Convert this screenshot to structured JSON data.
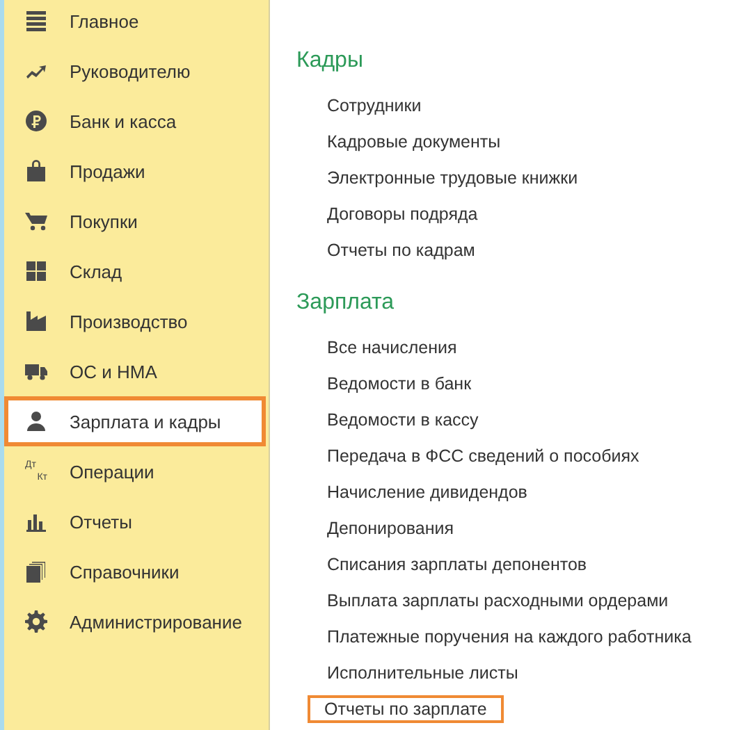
{
  "sidebar": {
    "items": [
      {
        "label": "Главное",
        "kind": "menu",
        "selected": false
      },
      {
        "label": "Руководителю",
        "kind": "trend",
        "selected": false
      },
      {
        "label": "Банк и касса",
        "kind": "ruble",
        "selected": false
      },
      {
        "label": "Продажи",
        "kind": "bag",
        "selected": false
      },
      {
        "label": "Покупки",
        "kind": "cart",
        "selected": false
      },
      {
        "label": "Склад",
        "kind": "grid",
        "selected": false
      },
      {
        "label": "Производство",
        "kind": "factory",
        "selected": false
      },
      {
        "label": "ОС и НМА",
        "kind": "truck",
        "selected": false
      },
      {
        "label": "Зарплата и кадры",
        "kind": "person",
        "selected": true
      },
      {
        "label": "Операции",
        "kind": "debit-credit",
        "icon_text": [
          "Дт",
          "Кт"
        ],
        "selected": false
      },
      {
        "label": "Отчеты",
        "kind": "chart",
        "selected": false
      },
      {
        "label": "Справочники",
        "kind": "books",
        "selected": false
      },
      {
        "label": "Администрирование",
        "kind": "gear",
        "selected": false
      }
    ]
  },
  "sections": [
    {
      "title": "Кадры",
      "links": [
        {
          "label": "Сотрудники",
          "highlighted": false
        },
        {
          "label": "Кадровые документы",
          "highlighted": false
        },
        {
          "label": "Электронные трудовые книжки",
          "highlighted": false
        },
        {
          "label": "Договоры подряда",
          "highlighted": false
        },
        {
          "label": "Отчеты по кадрам",
          "highlighted": false
        }
      ]
    },
    {
      "title": "Зарплата",
      "links": [
        {
          "label": "Все начисления",
          "highlighted": false
        },
        {
          "label": "Ведомости в банк",
          "highlighted": false
        },
        {
          "label": "Ведомости в кассу",
          "highlighted": false
        },
        {
          "label": "Передача в ФСС сведений о пособиях",
          "highlighted": false
        },
        {
          "label": "Начисление дивидендов",
          "highlighted": false
        },
        {
          "label": "Депонирования",
          "highlighted": false
        },
        {
          "label": "Списания зарплаты депонентов",
          "highlighted": false
        },
        {
          "label": "Выплата зарплаты расходными ордерами",
          "highlighted": false
        },
        {
          "label": "Платежные поручения на каждого работника",
          "highlighted": false
        },
        {
          "label": "Исполнительные листы",
          "highlighted": false
        },
        {
          "label": "Отчеты по зарплате",
          "highlighted": true
        }
      ]
    }
  ]
}
